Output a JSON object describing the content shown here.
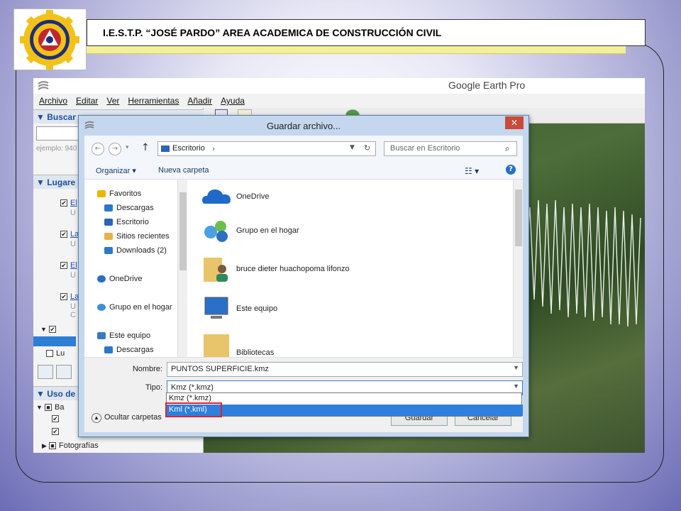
{
  "slide": {
    "title": "I.E.S.T.P. “JOSÉ PARDO” AREA ACADEMICA DE CONSTRUCCIÓN CIVIL"
  },
  "google_earth": {
    "window_title": "Google Earth Pro",
    "menu": [
      "Archivo",
      "Editar",
      "Ver",
      "Herramientas",
      "Añadir",
      "Ayuda"
    ],
    "panels": {
      "search": "▼ Buscar",
      "search_hint": "ejemplo: 940",
      "places": "▼ Lugare",
      "layers": "▼ Uso de",
      "places_items": [
        "El",
        "La",
        "El",
        "La"
      ],
      "places_sub": [
        "U",
        "U",
        "U",
        "U",
        "C"
      ],
      "folder_items": [
        "Lu"
      ],
      "layer_items": [
        "Ba",
        "Fotografías"
      ]
    }
  },
  "dialog": {
    "title": "Guardar archivo...",
    "close": "✕",
    "address": "Escritorio",
    "address_arrow": "›",
    "search_placeholder": "Buscar en Escritorio",
    "organize": "Organizar ▾",
    "new_folder": "Nueva carpeta",
    "nav_items": [
      {
        "label": "Favoritos",
        "icon": "star-icon",
        "color": "#f0b400"
      },
      {
        "label": "Descargas",
        "icon": "downloads-folder-icon",
        "color": "#2b78c9"
      },
      {
        "label": "Escritorio",
        "icon": "desktop-icon",
        "color": "#2a64b4"
      },
      {
        "label": "Sitios recientes",
        "icon": "recent-places-icon",
        "color": "#e6b34a"
      },
      {
        "label": "Downloads (2)",
        "icon": "downloads-folder-icon",
        "color": "#2b78c9"
      },
      {
        "label": "OneDrive",
        "icon": "onedrive-icon",
        "color": "#2b6cc4"
      },
      {
        "label": "Grupo en el hogar",
        "icon": "homegroup-icon",
        "color": "#3a8fd8"
      },
      {
        "label": "Este equipo",
        "icon": "computer-icon",
        "color": "#3c78c0"
      },
      {
        "label": "Descargas",
        "icon": "downloads-folder-icon",
        "color": "#2b78c9"
      }
    ],
    "files": [
      {
        "label": "OneDrive",
        "icon": "onedrive-icon",
        "color": "#1f6ac8"
      },
      {
        "label": "Grupo en el hogar",
        "icon": "homegroup-icon",
        "color": "#4aa0e0"
      },
      {
        "label": "bruce dieter huachopoma lifonzo",
        "icon": "user-folder-icon",
        "color": "#e8c56a"
      },
      {
        "label": "Este equipo",
        "icon": "computer-icon",
        "color": "#2a70c8"
      },
      {
        "label": "Bibliotecas",
        "icon": "libraries-icon",
        "color": "#e8c56a"
      }
    ],
    "name_label": "Nombre:",
    "name_value": "PUNTOS SUPERFICIE.kmz",
    "type_label": "Tipo:",
    "type_value": "Kmz (*.kmz)",
    "type_options": [
      "Kmz (*.kmz)",
      "Kml (*.kml)"
    ],
    "hide_folders": "Ocultar carpetas",
    "save": "Guardar",
    "cancel": "Cancelar"
  }
}
